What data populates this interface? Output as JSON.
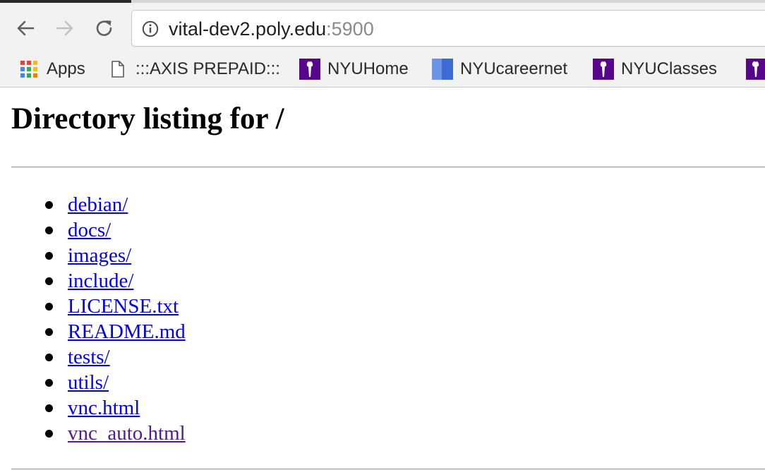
{
  "browser": {
    "url_host": "vital-dev2.poly.edu",
    "url_port": ":5900",
    "bookmarks": [
      {
        "label": "Apps",
        "icon": "apps-grid-icon"
      },
      {
        "label": ":::AXIS PREPAID:::",
        "icon": "page-icon"
      },
      {
        "label": "NYUHome",
        "icon": "nyu-torch-icon"
      },
      {
        "label": "NYUcareernet",
        "icon": "careernet-icon"
      },
      {
        "label": "NYUClasses",
        "icon": "nyu-torch-icon"
      }
    ],
    "colors": {
      "toolbar_bg": "#f2f2f2",
      "nyu_purple": "#57068c",
      "careernet_blue": "#3c6bd6"
    }
  },
  "page": {
    "heading": "Directory listing for /",
    "files": [
      {
        "name": "debian/",
        "visited": false
      },
      {
        "name": "docs/",
        "visited": false
      },
      {
        "name": "images/",
        "visited": false
      },
      {
        "name": "include/",
        "visited": false
      },
      {
        "name": "LICENSE.txt",
        "visited": false
      },
      {
        "name": "README.md",
        "visited": false
      },
      {
        "name": "tests/",
        "visited": false
      },
      {
        "name": "utils/",
        "visited": false
      },
      {
        "name": "vnc.html",
        "visited": false
      },
      {
        "name": "vnc_auto.html",
        "visited": true
      }
    ],
    "colors": {
      "link": "#0000ee",
      "visited_link": "#551a8b"
    }
  }
}
